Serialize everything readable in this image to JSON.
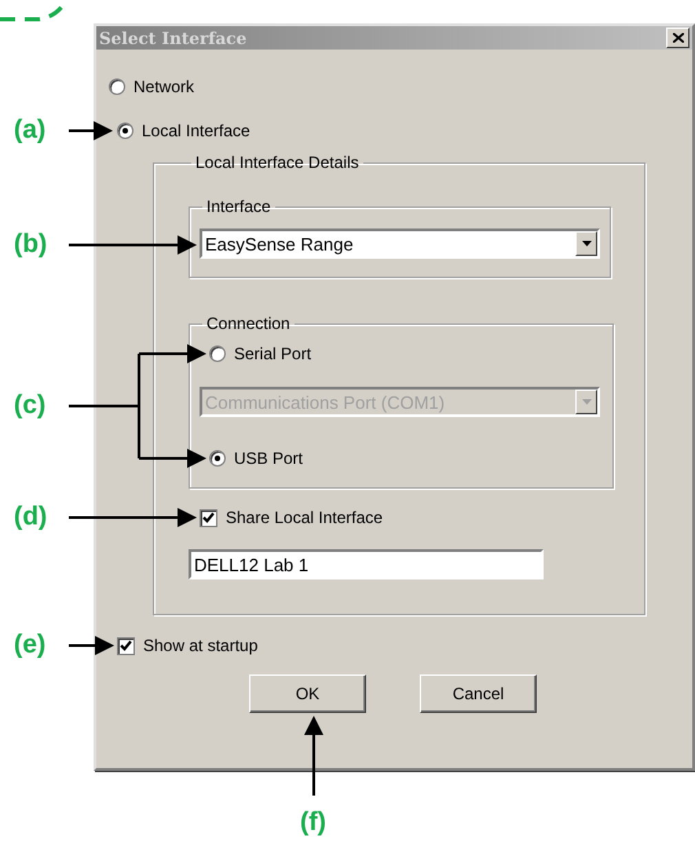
{
  "window": {
    "title": "Select Interface"
  },
  "mode_options": [
    {
      "label": "Network",
      "selected": false
    },
    {
      "label": "Local Interface",
      "selected": true
    }
  ],
  "local_details": {
    "title": "Local Interface Details",
    "interface_group": {
      "title": "Interface",
      "value": "EasySense Range"
    },
    "connection_group": {
      "title": "Connection",
      "options": [
        {
          "label": "Serial Port",
          "selected": false
        },
        {
          "label": "USB Port",
          "selected": true
        }
      ],
      "port": {
        "value": "Communications Port (COM1)",
        "disabled": true
      }
    },
    "share": {
      "label": "Share Local Interface",
      "checked": true
    },
    "share_name": "DELL12 Lab 1"
  },
  "show_at_startup": {
    "label": "Show at startup",
    "checked": true
  },
  "buttons": [
    "OK",
    "Cancel"
  ],
  "annotations": [
    "(a)",
    "(b)",
    "(c)",
    "(d)",
    "(e)",
    "(f)"
  ]
}
